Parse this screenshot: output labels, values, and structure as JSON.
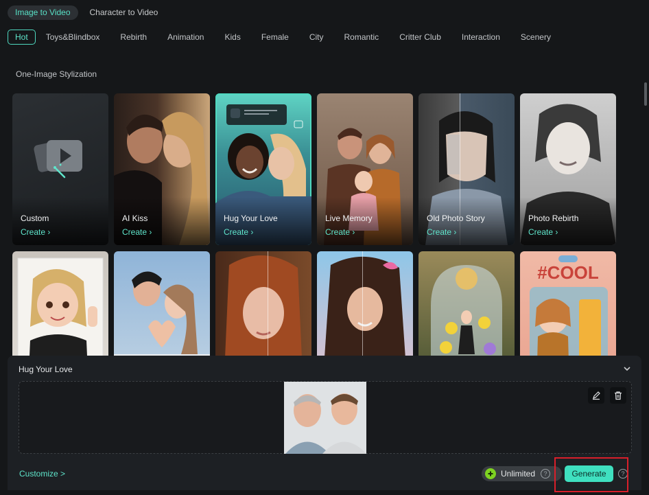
{
  "mode_tabs": [
    {
      "label": "Image to Video",
      "active": true
    },
    {
      "label": "Character to Video",
      "active": false
    }
  ],
  "categories": [
    "Hot",
    "Toys&Blindbox",
    "Rebirth",
    "Animation",
    "Kids",
    "Female",
    "City",
    "Romantic",
    "Critter Club",
    "Interaction",
    "Scenery",
    "One-Image Stylization"
  ],
  "active_category": "Hot",
  "cards": [
    {
      "title": "Custom",
      "action": "Create"
    },
    {
      "title": "AI Kiss",
      "action": "Create"
    },
    {
      "title": "Hug Your Love",
      "action": "Create",
      "selected": true
    },
    {
      "title": "Live Memory",
      "action": "Create"
    },
    {
      "title": "Old Photo Story",
      "action": "Create"
    },
    {
      "title": "Photo Rebirth",
      "action": "Create"
    }
  ],
  "second_row_art_text": "#COOL",
  "panel": {
    "title": "Hug Your Love",
    "customize": "Customize >",
    "credits_label": "Unlimited",
    "generate_label": "Generate"
  },
  "colors": {
    "accent": "#4fd9c0",
    "generate_bg": "#3fe0c0",
    "highlight": "#d91f2a",
    "credits_badge": "#7ed321"
  },
  "icons": [
    "chevron-down-icon",
    "edit-icon",
    "delete-icon",
    "help-icon",
    "custom-media-icon",
    "credits-icon"
  ]
}
